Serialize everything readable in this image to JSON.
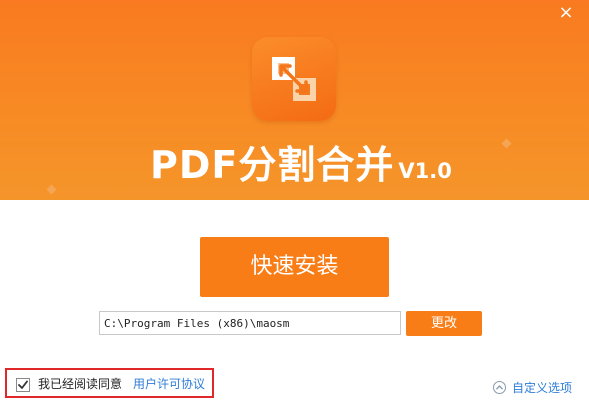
{
  "window": {
    "close_glyph": "×"
  },
  "banner": {
    "app_name": "PDF分割合并",
    "version": "V1.0",
    "logo_icon": "split-merge-icon",
    "background_color": "#f97a20"
  },
  "install": {
    "button_label": "快速安装",
    "path_value": "C:\\Program Files (x86)\\maosm",
    "change_label": "更改"
  },
  "agreement": {
    "checked": true,
    "text": "我已经阅读同意",
    "link_label": "用户许可协议"
  },
  "options": {
    "custom_label": "自定义选项",
    "custom_icon": "chevron-up-circle-icon"
  },
  "colors": {
    "accent": "#f97d16",
    "link": "#2f7dd8",
    "highlight_border": "#e0272a"
  }
}
